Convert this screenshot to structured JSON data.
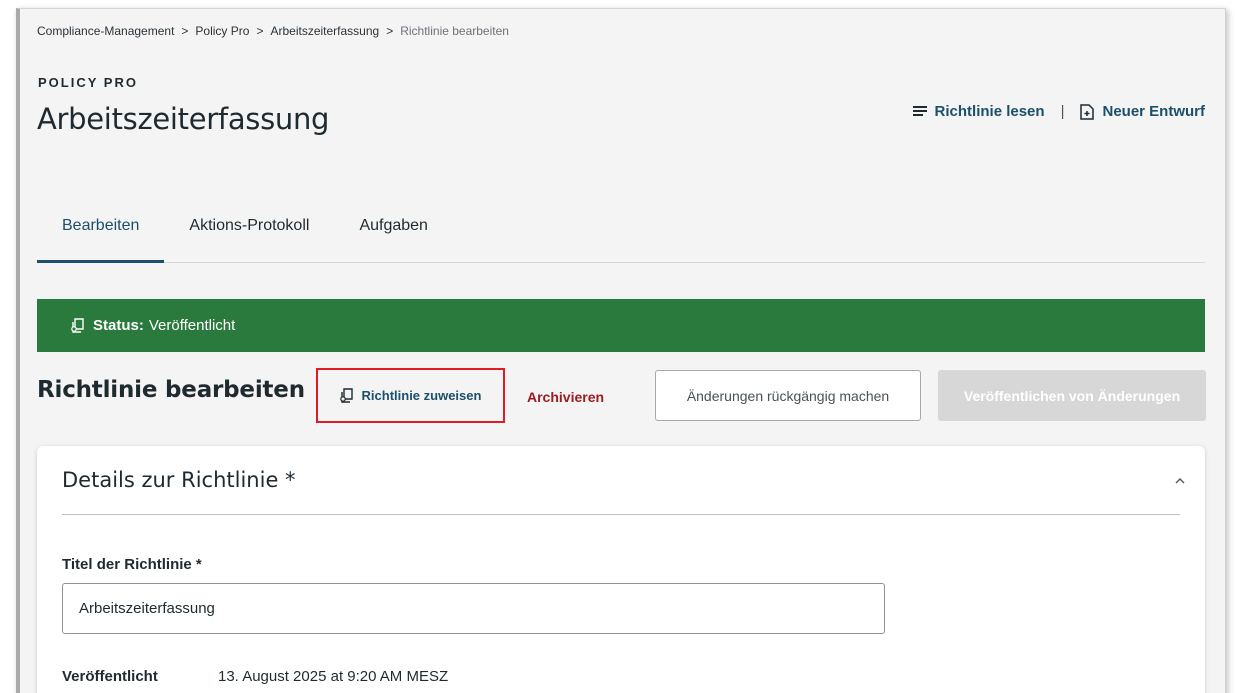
{
  "breadcrumb": {
    "items": [
      "Compliance-Management",
      "Policy Pro",
      "Arbeitszeiterfassung",
      "Richtlinie bearbeiten"
    ],
    "separator": ">"
  },
  "header": {
    "eyebrow": "POLICY PRO",
    "title": "Arbeitszeiterfassung",
    "actions": {
      "read_label": "Richtlinie lesen",
      "divider": "|",
      "draft_label": "Neuer Entwurf"
    }
  },
  "tabs": [
    {
      "label": "Bearbeiten",
      "active": true
    },
    {
      "label": "Aktions-Protokoll",
      "active": false
    },
    {
      "label": "Aufgaben",
      "active": false
    }
  ],
  "status": {
    "label": "Status:",
    "value": "Veröffentlicht",
    "color": "#2b7a3d"
  },
  "toolbar": {
    "title": "Richtlinie bearbeiten",
    "assign_label": "Richtlinie zuweisen",
    "archive_label": "Archivieren",
    "revert_label": "Änderungen rückgängig machen",
    "publish_label": "Veröffentlichen von Änderungen",
    "highlight_color": "#e01b24"
  },
  "details": {
    "title": "Details zur Richtlinie *",
    "title_field_label": "Titel der Richtlinie *",
    "title_field_value": "Arbeitszeiterfassung",
    "published_label": "Veröffentlicht",
    "published_value": "13. August 2025 at 9:20 AM MESZ"
  },
  "colors": {
    "accent": "#1b4f6b",
    "danger": "#9b1d20"
  },
  "icons": {
    "read": "list-lines-icon",
    "draft": "new-document-icon",
    "status": "policy-stack-icon",
    "assign": "policy-stack-icon",
    "collapse": "chevron-up-icon"
  }
}
